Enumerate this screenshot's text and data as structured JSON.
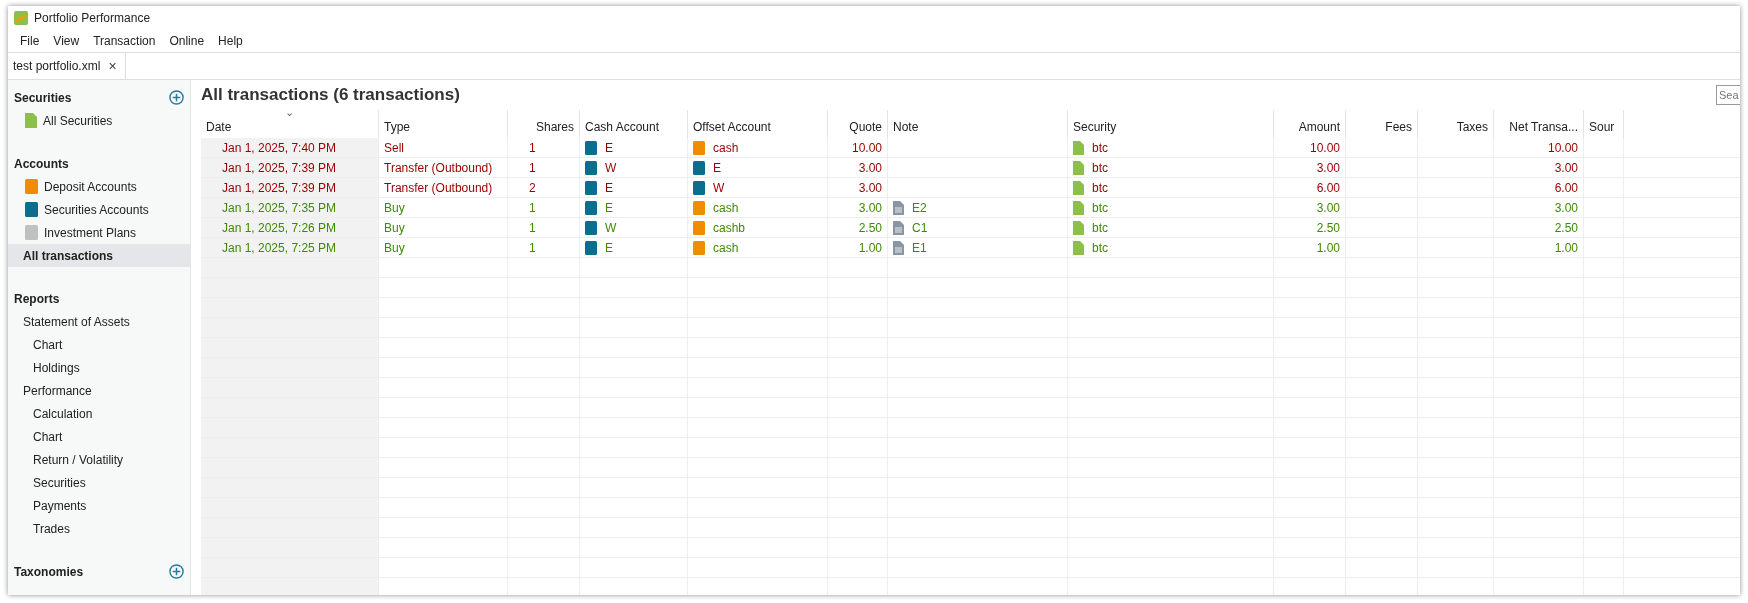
{
  "window": {
    "title": "Portfolio Performance"
  },
  "menu": [
    "File",
    "View",
    "Transaction",
    "Online",
    "Help"
  ],
  "editor_tabs": [
    {
      "label": "test portfolio.xml",
      "close": "×",
      "selected": true
    }
  ],
  "sidebar": {
    "sections": [
      {
        "title": "Securities",
        "add": true,
        "items": [
          {
            "label": "All Securities",
            "kind": "security",
            "selected": false
          }
        ]
      },
      {
        "title": "Accounts",
        "add": false,
        "items": [
          {
            "label": "Deposit Accounts",
            "kind": "deposit",
            "selected": false
          },
          {
            "label": "Securities Accounts",
            "kind": "securities",
            "selected": false
          },
          {
            "label": "Investment Plans",
            "kind": "plan",
            "selected": false
          },
          {
            "label": "All transactions",
            "kind": "view",
            "selected": true
          }
        ]
      },
      {
        "title": "Reports",
        "add": false,
        "items": [
          {
            "label": "Statement of Assets",
            "kind": "view",
            "selected": false,
            "children": [
              {
                "label": "Chart",
                "selected": false
              },
              {
                "label": "Holdings",
                "selected": false
              }
            ]
          },
          {
            "label": "Performance",
            "kind": "view",
            "selected": false,
            "children": [
              {
                "label": "Calculation",
                "selected": false
              },
              {
                "label": "Chart",
                "selected": false
              },
              {
                "label": "Return / Volatility",
                "selected": false
              },
              {
                "label": "Securities",
                "selected": false
              },
              {
                "label": "Payments",
                "selected": false
              },
              {
                "label": "Trades",
                "selected": false
              }
            ]
          }
        ]
      },
      {
        "title": "Taxonomies",
        "add": true
      }
    ]
  },
  "page_title": "All transactions (6 transactions)",
  "search": {
    "placeholder": "Sea"
  },
  "table": {
    "sort_indicator": "⌄",
    "columns": [
      "Date",
      "Type",
      "Shares",
      "Cash Account",
      "Offset Account",
      "Quote",
      "Note",
      "Security",
      "Amount",
      "Fees",
      "Taxes",
      "Net Transa...",
      "Sour"
    ],
    "rows": [
      {
        "color": "#990000",
        "date": "Jan 1, 2025, 7:40 PM",
        "type": "Sell",
        "shares": "1",
        "cash_account": {
          "name": "E",
          "kind": "securities"
        },
        "offset_account": {
          "name": "cash",
          "kind": "deposit"
        },
        "quote": "10.00",
        "security": "btc",
        "amount": "10.00",
        "net": "10.00"
      },
      {
        "color": "#990000",
        "date": "Jan 1, 2025, 7:39 PM",
        "type": "Transfer (Outbound)",
        "shares": "1",
        "cash_account": {
          "name": "W",
          "kind": "securities"
        },
        "offset_account": {
          "name": "E",
          "kind": "securities"
        },
        "quote": "3.00",
        "security": "btc",
        "amount": "3.00",
        "net": "3.00"
      },
      {
        "color": "#990000",
        "date": "Jan 1, 2025, 7:39 PM",
        "type": "Transfer (Outbound)",
        "shares": "2",
        "cash_account": {
          "name": "E",
          "kind": "securities"
        },
        "offset_account": {
          "name": "W",
          "kind": "securities"
        },
        "quote": "3.00",
        "security": "btc",
        "amount": "6.00",
        "net": "6.00"
      },
      {
        "color": "#3e8a00",
        "date": "Jan 1, 2025, 7:35 PM",
        "type": "Buy",
        "shares": "1",
        "cash_account": {
          "name": "E",
          "kind": "securities"
        },
        "offset_account": {
          "name": "cash",
          "kind": "deposit"
        },
        "quote": "3.00",
        "note": "E2",
        "security": "btc",
        "amount": "3.00",
        "net": "3.00"
      },
      {
        "color": "#3e8a00",
        "date": "Jan 1, 2025, 7:26 PM",
        "type": "Buy",
        "shares": "1",
        "cash_account": {
          "name": "W",
          "kind": "securities"
        },
        "offset_account": {
          "name": "cashb",
          "kind": "deposit"
        },
        "quote": "2.50",
        "note": "C1",
        "security": "btc",
        "amount": "2.50",
        "net": "2.50"
      },
      {
        "color": "#3e8a00",
        "date": "Jan 1, 2025, 7:25 PM",
        "type": "Buy",
        "shares": "1",
        "cash_account": {
          "name": "E",
          "kind": "securities"
        },
        "offset_account": {
          "name": "cash",
          "kind": "deposit"
        },
        "quote": "1.00",
        "note": "E1",
        "security": "btc",
        "amount": "1.00",
        "net": "1.00"
      }
    ]
  }
}
